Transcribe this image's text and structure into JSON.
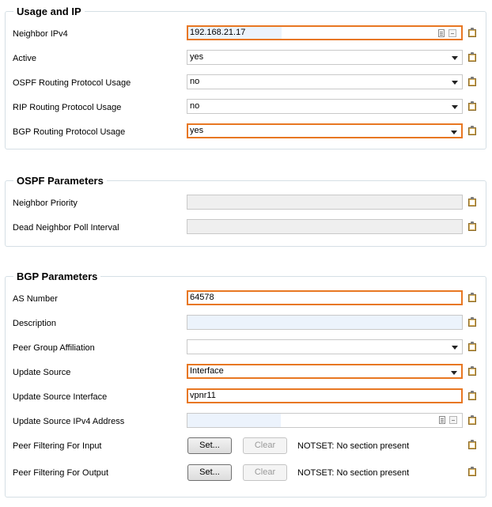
{
  "groups": {
    "usage": {
      "title": "Usage and IP",
      "rows": [
        {
          "label": "Neighbor IPv4",
          "value": "192.168.21.17"
        },
        {
          "label": "Active",
          "value": "yes"
        },
        {
          "label": "OSPF Routing Protocol Usage",
          "value": "no"
        },
        {
          "label": "RIP Routing Protocol Usage",
          "value": "no"
        },
        {
          "label": "BGP Routing Protocol Usage",
          "value": "yes"
        }
      ]
    },
    "ospf": {
      "title": "OSPF Parameters",
      "rows": [
        {
          "label": "Neighbor Priority",
          "value": ""
        },
        {
          "label": "Dead Neighbor Poll Interval",
          "value": ""
        }
      ]
    },
    "bgp": {
      "title": "BGP Parameters",
      "rows": [
        {
          "label": "AS Number",
          "value": "64578"
        },
        {
          "label": "Description",
          "value": ""
        },
        {
          "label": "Peer Group Affiliation",
          "value": ""
        },
        {
          "label": "Update Source",
          "value": "Interface"
        },
        {
          "label": "Update Source Interface",
          "value": "vpnr11"
        },
        {
          "label": "Update Source IPv4 Address",
          "value": ""
        },
        {
          "label": "Peer Filtering For Input",
          "set_label": "Set...",
          "clear_label": "Clear",
          "status": "NOTSET: No section present"
        },
        {
          "label": "Peer Filtering For Output",
          "set_label": "Set...",
          "clear_label": "Clear",
          "status": "NOTSET: No section present"
        }
      ]
    }
  },
  "colors": {
    "highlight_border": "#e87722",
    "group_border": "#d5dfe5",
    "field_tint": "#ecf3fc"
  },
  "icons": {
    "row_action": "clipboard-icon",
    "ip_helpers": [
      "ip-list-icon",
      "ip-collapse-icon"
    ],
    "dropdown": "chevron-down-icon"
  }
}
